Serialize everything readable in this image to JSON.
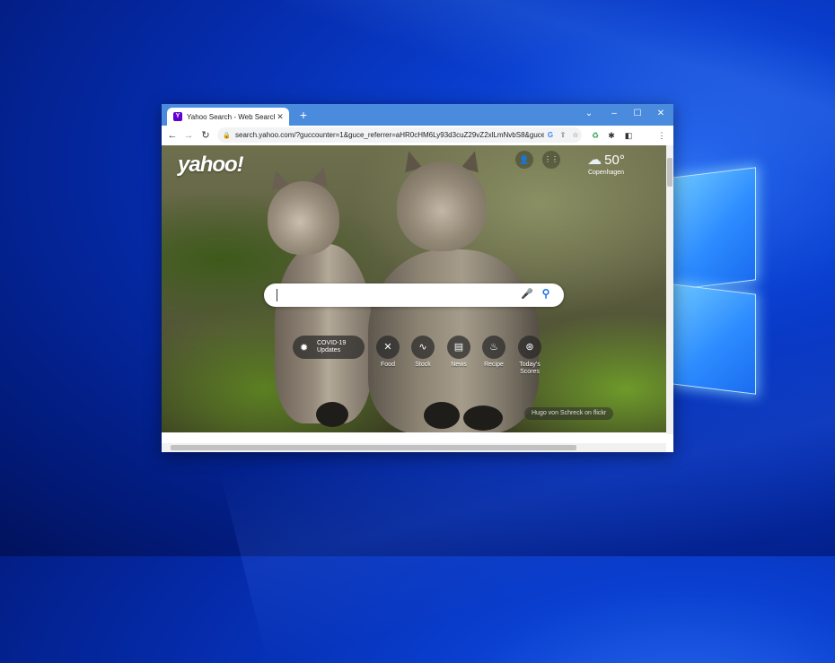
{
  "desktop": {
    "background": "#0a3fd0"
  },
  "browser": {
    "tab": {
      "title": "Yahoo Search - Web Search",
      "favicon": "Y",
      "close": "✕"
    },
    "newtab": "+",
    "window_controls": {
      "minimize": "–",
      "maximize": "☐",
      "close": "✕",
      "dropdown": "⌄"
    },
    "nav": {
      "back": "←",
      "forward": "→",
      "reload": "↻"
    },
    "url": "search.yahoo.com/?guccounter=1&guce_referrer=aHR0cHM6Ly93d3cuZ29vZ2xlLmNvbS8&guce_...",
    "omnibox_icons": {
      "lock": "🔒",
      "google": "G",
      "share": "⇪",
      "star": "☆"
    },
    "extensions": {
      "ext1": "♻",
      "puzzle": "✱",
      "sidepanel": "◧",
      "menu": "⋮"
    }
  },
  "page": {
    "logo": "yahoo!",
    "header_buttons": {
      "account": "👤",
      "apps": "⋮⋮"
    },
    "weather": {
      "icon": "cloud-icon",
      "temperature": "50°",
      "city": "Copenhagen"
    },
    "search": {
      "placeholder": "",
      "mic": "🎤",
      "search": "⚲"
    },
    "covid": {
      "label": "COVID-19\nUpdates"
    },
    "quick_links": [
      {
        "label": "Food",
        "icon": "✕"
      },
      {
        "label": "Stock",
        "icon": "∿"
      },
      {
        "label": "News",
        "icon": "▤"
      },
      {
        "label": "Recipe",
        "icon": "♨"
      },
      {
        "label": "Today's Scores",
        "icon": "⊛"
      }
    ],
    "photo_credit": "Hugo von Schreck on flickr"
  }
}
